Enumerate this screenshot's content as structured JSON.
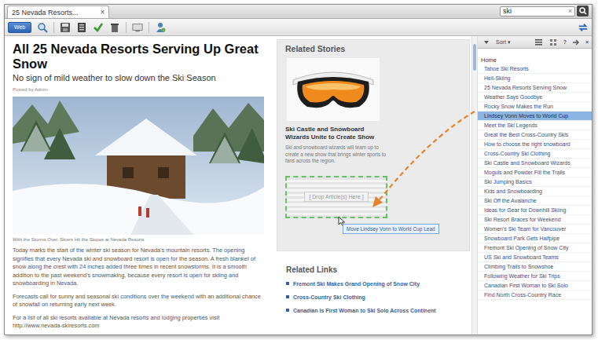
{
  "tab": {
    "label": "25 Nevada Resorts...",
    "close": "×"
  },
  "search": {
    "value": "ski",
    "clear": "×"
  },
  "toolbar": {
    "view_button": "Web"
  },
  "article": {
    "title": "All 25 Nevada Resorts Serving Up Great Snow",
    "subtitle": "No sign of mild weather to slow down the Ski Season",
    "byline": "Posted by Admin",
    "caption": "With the Storms Over, Skiers Hit the Slopes at Nevada Resorts",
    "paragraphs": [
      "Today marks the start of the winter ski season for Nevada's mountain resorts. The opening signifies that every Nevada ski and snowboard resort is open for the season. A fresh blanket of snow along the crest with 24 inches added three times in recent snowstorms. It is a smooth addition to the past weekend's snowmaking, because every resort is open for skiing and snowboarding in Nevada.",
      "Forecasts call for sunny and seasonal ski conditions over the weekend with an additional chance of snowfall on returning early next week.",
      "For a list of all ski resorts available at Nevada resorts and lodging properties visit http://www.nevada-skiresorts.com"
    ]
  },
  "related_stories": {
    "heading": "Related Stories",
    "story_title": "Ski Castle and Snowboard Wizards Unite to Create Show",
    "story_summary": "Ski and snowboard wizards will team up to create a new show that brings winter sports to fans across the region.",
    "drop_zone": "[ Drop Article(s) Here ]"
  },
  "drag_tooltip": "Move Lindsey Vonn to World Cup Lead",
  "related_links": {
    "heading": "Related Links",
    "links": [
      "Fremont Ski Makes Grand Opening of Snow City",
      "Cross-Country Ski Clothing",
      "Canadian Is First Woman to Ski Solo Across Continent"
    ]
  },
  "panel": {
    "sort": "Sort ▾",
    "help": "?",
    "close": "×",
    "root": "Home",
    "items": [
      {
        "label": "Tahoe Ski Resorts",
        "selected": false
      },
      {
        "label": "Heli-Skiing",
        "selected": false
      },
      {
        "label": "25 Nevada Resorts Serving Snow",
        "selected": false
      },
      {
        "label": "Weather Says Goodbye",
        "selected": false
      },
      {
        "label": "Rocky Snow Makes the Run",
        "selected": false
      },
      {
        "label": "Lindsey Vonn Moves to World Cup",
        "selected": true
      },
      {
        "label": "Meet the Ski Legends",
        "selected": false
      },
      {
        "label": "Great the Best Cross-Country Skis",
        "selected": false
      },
      {
        "label": "How to choose the right snowboard",
        "selected": false
      },
      {
        "label": "Cross-Country Ski Clothing",
        "selected": false
      },
      {
        "label": "Ski Castle and Snowboard Wizards",
        "selected": false
      },
      {
        "label": "Moguls and Powder Fill the Trails",
        "selected": false
      },
      {
        "label": "Ski Jumping Basics",
        "selected": false
      },
      {
        "label": "Kids and Snowboarding",
        "selected": false
      },
      {
        "label": "Ski Off the Avalanche",
        "selected": false
      },
      {
        "label": "Ideas for Gear for Downhill Skiing",
        "selected": false
      },
      {
        "label": "Ski Resort Braces for Weekend",
        "selected": false
      },
      {
        "label": "Women's Ski Team for Vancouver",
        "selected": false
      },
      {
        "label": "Snowboard Park Gets Halfpipe",
        "selected": false
      },
      {
        "label": "Fremont Ski Opening of Snow City",
        "selected": false
      },
      {
        "label": "US Ski and Snowboard Teams",
        "selected": false
      },
      {
        "label": "Climbing Trails to Snowshoe",
        "selected": false
      },
      {
        "label": "Following Weather for Ski Trips",
        "selected": false
      },
      {
        "label": "Canadian First Woman to Ski Solo",
        "selected": false
      },
      {
        "label": "Find North Cross-Country Race",
        "selected": false
      }
    ]
  }
}
